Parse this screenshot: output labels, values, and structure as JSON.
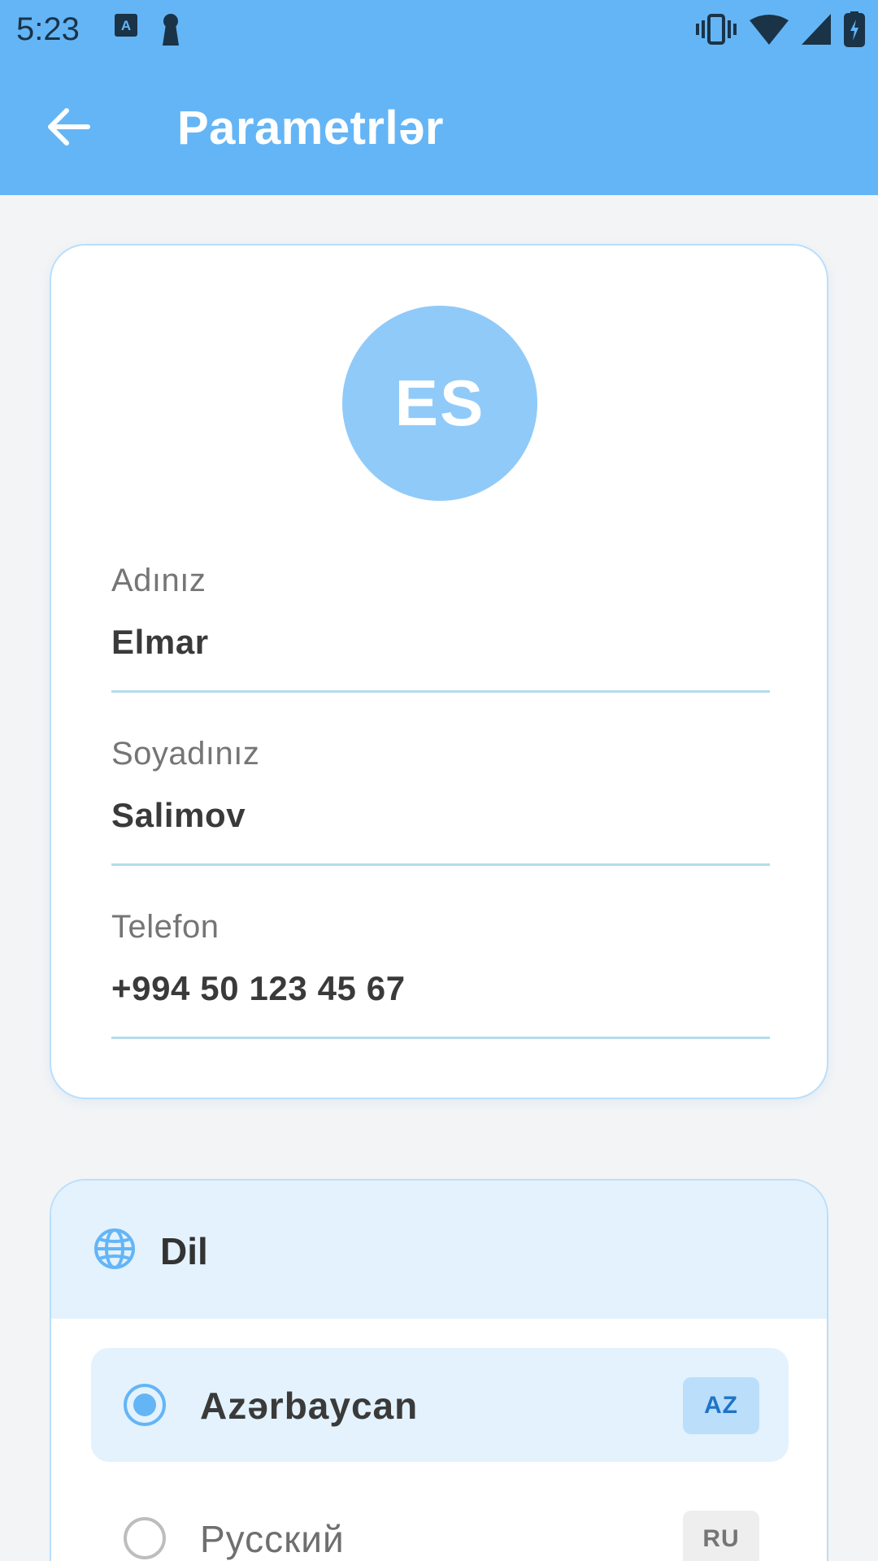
{
  "status_bar": {
    "time": "5:23",
    "left_icons": [
      "keyboard-a-icon",
      "keyhole-icon"
    ],
    "right_icons": [
      "vibrate-icon",
      "wifi-icon",
      "signal-icon",
      "battery-charging-icon"
    ]
  },
  "app_bar": {
    "title": "Parametrlər",
    "back_icon": "arrow-left-icon"
  },
  "profile": {
    "avatar_initials": "ES",
    "fields": [
      {
        "label": "Adınız",
        "value": "Elmar"
      },
      {
        "label": "Soyadınız",
        "value": "Salimov"
      },
      {
        "label": "Telefon",
        "value": "+994 50 123 45 67"
      }
    ]
  },
  "language": {
    "title": "Dil",
    "icon": "globe-icon",
    "options": [
      {
        "name": "Azərbaycan",
        "code": "AZ",
        "selected": true
      },
      {
        "name": "Русский",
        "code": "RU",
        "selected": false
      }
    ]
  },
  "colors": {
    "primary": "#64b5f6",
    "avatar": "#90caf9",
    "card_border": "#bbdefb",
    "selected_bg": "#e3f2fd"
  }
}
